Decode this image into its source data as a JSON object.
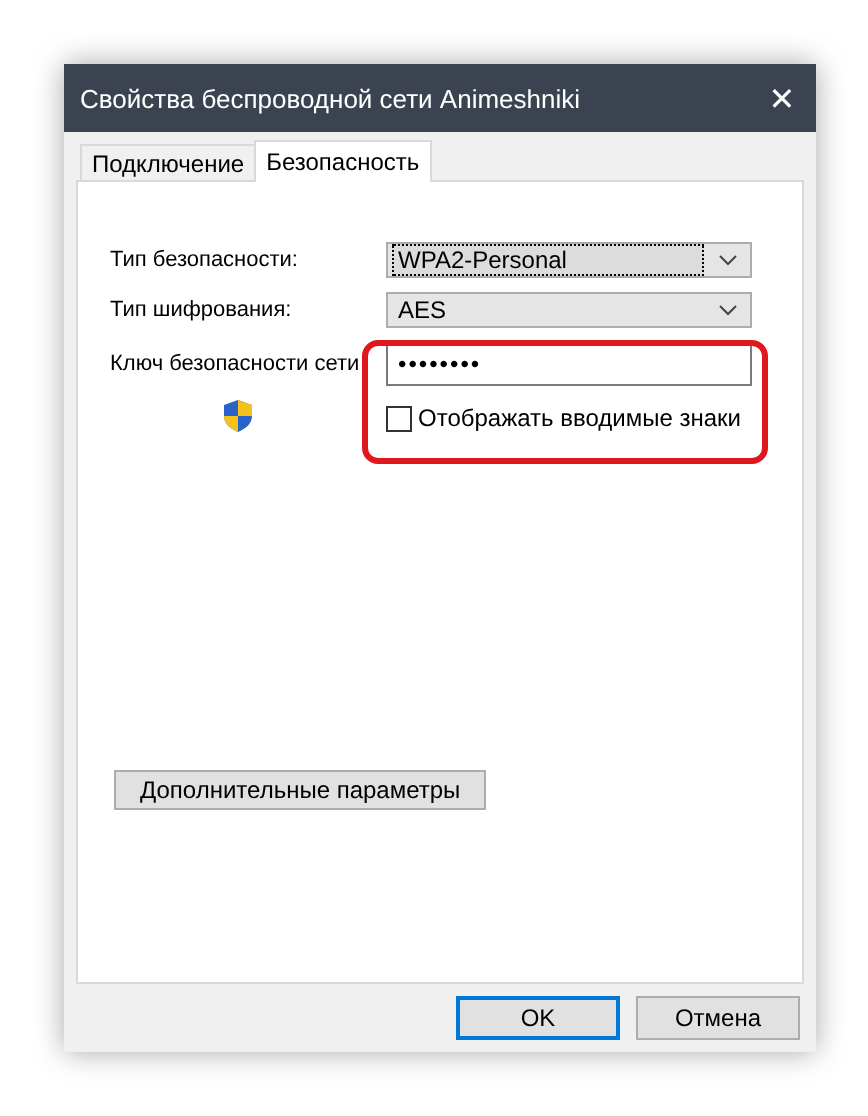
{
  "window": {
    "title": "Свойства беспроводной сети Animeshniki",
    "close": "✕"
  },
  "tabs": [
    {
      "label": "Подключение",
      "selected": false
    },
    {
      "label": "Безопасность",
      "selected": true
    }
  ],
  "fields": [
    {
      "kind": "select",
      "label": "Тип безопасности:",
      "value": "WPA2-Personal",
      "focused": true
    },
    {
      "kind": "select",
      "label": "Тип шифрования:",
      "value": "AES",
      "focused": false
    },
    {
      "kind": "password",
      "label": "Ключ безопасности сети",
      "value": "••••••••"
    }
  ],
  "show_chars": {
    "label": "Отображать вводимые знаки",
    "checked": false
  },
  "advanced_button": "Дополнительные параметры",
  "buttons": [
    {
      "label": "OK",
      "default": true
    },
    {
      "label": "Отмена",
      "default": false
    }
  ]
}
